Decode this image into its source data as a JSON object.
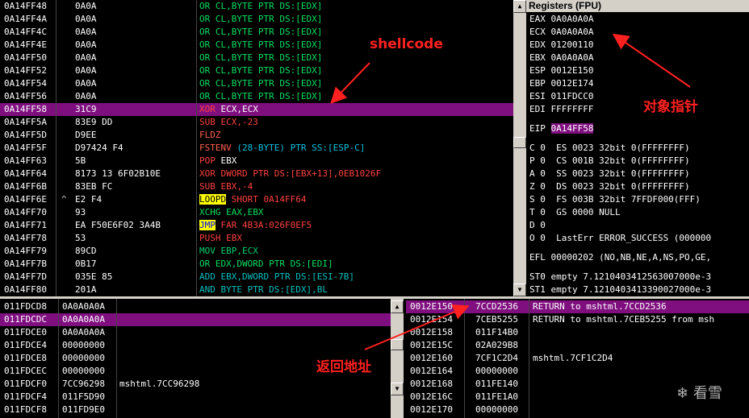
{
  "disasm": [
    {
      "addr": "0A14FF48",
      "mark": "",
      "hex": "0A0A",
      "ins": [
        [
          "OR",
          "t-or"
        ],
        [
          " CL,BYTE PTR DS:[EDX]",
          "t-or"
        ]
      ]
    },
    {
      "addr": "0A14FF4A",
      "mark": "",
      "hex": "0A0A",
      "ins": [
        [
          "OR",
          "t-or"
        ],
        [
          " CL,BYTE PTR DS:[EDX]",
          "t-or"
        ]
      ]
    },
    {
      "addr": "0A14FF4C",
      "mark": "",
      "hex": "0A0A",
      "ins": [
        [
          "OR",
          "t-or"
        ],
        [
          " CL,BYTE PTR DS:[EDX]",
          "t-or"
        ]
      ]
    },
    {
      "addr": "0A14FF4E",
      "mark": "",
      "hex": "0A0A",
      "ins": [
        [
          "OR",
          "t-or"
        ],
        [
          " CL,BYTE PTR DS:[EDX]",
          "t-or"
        ]
      ]
    },
    {
      "addr": "0A14FF50",
      "mark": "",
      "hex": "0A0A",
      "ins": [
        [
          "OR",
          "t-or"
        ],
        [
          " CL,BYTE PTR DS:[EDX]",
          "t-or"
        ]
      ]
    },
    {
      "addr": "0A14FF52",
      "mark": "",
      "hex": "0A0A",
      "ins": [
        [
          "OR",
          "t-or"
        ],
        [
          " CL,BYTE PTR DS:[EDX]",
          "t-or"
        ]
      ]
    },
    {
      "addr": "0A14FF54",
      "mark": "",
      "hex": "0A0A",
      "ins": [
        [
          "OR",
          "t-or"
        ],
        [
          " CL,BYTE PTR DS:[EDX]",
          "t-or"
        ]
      ]
    },
    {
      "addr": "0A14FF56",
      "mark": "",
      "hex": "0A0A",
      "ins": [
        [
          "OR",
          "t-or"
        ],
        [
          " CL,BYTE PTR DS:[EDX]",
          "t-or"
        ]
      ]
    },
    {
      "addr": "0A14FF58",
      "mark": "",
      "hex": "31C9",
      "sel": true,
      "ins": [
        [
          "XOR",
          "t-kw"
        ],
        [
          " ECX,ECX",
          "t-num"
        ]
      ]
    },
    {
      "addr": "0A14FF5A",
      "mark": "",
      "hex": "83E9 DD",
      "ins": [
        [
          "SUB",
          "t-kw"
        ],
        [
          " ECX,-23",
          "t-kw"
        ]
      ]
    },
    {
      "addr": "0A14FF5D",
      "mark": "",
      "hex": "D9EE",
      "ins": [
        [
          "FLDZ",
          "t-fpu"
        ]
      ]
    },
    {
      "addr": "0A14FF5F",
      "mark": "",
      "hex": "D97424 F4",
      "ins": [
        [
          "FSTENV",
          "t-fpu"
        ],
        [
          " (28-BYTE) PTR SS:[ESP-C]",
          "t-cyan"
        ]
      ]
    },
    {
      "addr": "0A14FF63",
      "mark": "",
      "hex": "5B",
      "ins": [
        [
          "POP",
          "t-push"
        ],
        [
          " EBX",
          "t-num"
        ]
      ]
    },
    {
      "addr": "0A14FF64",
      "mark": "",
      "hex": "8173 13 6F02B10E",
      "ins": [
        [
          "XOR",
          "t-kw"
        ],
        [
          " DWORD PTR DS:[EBX+13],0EB1026F",
          "t-kw"
        ]
      ]
    },
    {
      "addr": "0A14FF6B",
      "mark": "",
      "hex": "83EB FC",
      "ins": [
        [
          "SUB",
          "t-kw"
        ],
        [
          " EBX,-4",
          "t-kw"
        ]
      ]
    },
    {
      "addr": "0A14FF6E",
      "mark": "^",
      "hex": "E2 F4",
      "ins": [
        [
          "LOOPD",
          "t-loop"
        ],
        [
          " SHORT 0A14FF64",
          "t-kw"
        ]
      ]
    },
    {
      "addr": "0A14FF70",
      "mark": "",
      "hex": "93",
      "ins": [
        [
          "XCHG EAX,EBX",
          "t-xchg"
        ]
      ]
    },
    {
      "addr": "0A14FF71",
      "mark": "",
      "hex": "EA F50E6F02 3A4B",
      "ins": [
        [
          "JMP",
          "t-call"
        ],
        [
          " FAR 4B3A:026F0EF5",
          "t-kw"
        ]
      ]
    },
    {
      "addr": "0A14FF78",
      "mark": "",
      "hex": "53",
      "ins": [
        [
          "PUSH EBX",
          "t-push"
        ]
      ]
    },
    {
      "addr": "0A14FF79",
      "mark": "",
      "hex": "89CD",
      "ins": [
        [
          "MOV EBP,ECX",
          "t-mov"
        ]
      ]
    },
    {
      "addr": "0A14FF7B",
      "mark": "",
      "hex": "0B17",
      "ins": [
        [
          "OR EDX,DWORD PTR DS:[EDI]",
          "t-or"
        ]
      ]
    },
    {
      "addr": "0A14FF7D",
      "mark": "",
      "hex": "035E 85",
      "ins": [
        [
          "ADD EBX,DWORD PTR DS:[ESI-7B]",
          "t-add"
        ]
      ]
    },
    {
      "addr": "0A14FF80",
      "mark": "",
      "hex": "201A",
      "ins": [
        [
          "AND BYTE PTR DS:[EDX],BL",
          "t-and"
        ]
      ]
    }
  ],
  "registers": {
    "title": "Registers (FPU)",
    "lines": [
      "EAX 0A0A0A0A",
      "ECX 0A0A0A0A",
      "EDX 01200110",
      "EBX 0A0A0A0A",
      "ESP 0012E150",
      "EBP 0012E174",
      "ESI 011FDCC0",
      "EDI FFFFFFFF"
    ],
    "eip_label": "EIP ",
    "eip_value": "0A14FF58",
    "flags": [
      "C 0  ES 0023 32bit 0(FFFFFFFF)",
      "P 0  CS 001B 32bit 0(FFFFFFFF)",
      "A 0  SS 0023 32bit 0(FFFFFFFF)",
      "Z 0  DS 0023 32bit 0(FFFFFFFF)",
      "S 0  FS 003B 32bit 7FFDF000(FFF)",
      "T 0  GS 0000 NULL",
      "D 0",
      "O 0  LastErr ERROR_SUCCESS (000000"
    ],
    "efl": "EFL 00000202 (NO,NB,NE,A,NS,PO,GE,",
    "st": [
      "ST0 empty 7.1210403412563007000e-3",
      "ST1 empty 7.1210403413390027000e-3"
    ]
  },
  "dump": [
    {
      "addr": "011FDCD8",
      "val": "0A0A0A0A",
      "cmt": ""
    },
    {
      "addr": "011FDCDC",
      "val": "0A0A0A0A",
      "cmt": "",
      "sel": true
    },
    {
      "addr": "011FDCE0",
      "val": "0A0A0A0A",
      "cmt": ""
    },
    {
      "addr": "011FDCE4",
      "val": "00000000",
      "cmt": ""
    },
    {
      "addr": "011FDCE8",
      "val": "00000000",
      "cmt": ""
    },
    {
      "addr": "011FDCEC",
      "val": "00000000",
      "cmt": ""
    },
    {
      "addr": "011FDCF0",
      "val": "7CC96298",
      "cmt": "mshtml.7CC96298"
    },
    {
      "addr": "011FDCF4",
      "val": "011F5D90",
      "cmt": ""
    },
    {
      "addr": "011FDCF8",
      "val": "011FD9E0",
      "cmt": ""
    }
  ],
  "stack": [
    {
      "addr": "0012E150",
      "val": "7CCD2536",
      "cmt": "RETURN to mshtml.7CCD2536",
      "sel": true
    },
    {
      "addr": "0012E154",
      "val": "7CEB5255",
      "cmt": "RETURN to mshtml.7CEB5255 from msh"
    },
    {
      "addr": "0012E158",
      "val": "011F14B0",
      "cmt": ""
    },
    {
      "addr": "0012E15C",
      "val": "02A029B8",
      "cmt": ""
    },
    {
      "addr": "0012E160",
      "val": "7CF1C2D4",
      "cmt": "mshtml.7CF1C2D4"
    },
    {
      "addr": "0012E164",
      "val": "00000000",
      "cmt": ""
    },
    {
      "addr": "0012E168",
      "val": "011FE140",
      "cmt": ""
    },
    {
      "addr": "0012E16C",
      "val": "011FE1A0",
      "cmt": ""
    },
    {
      "addr": "0012E170",
      "val": "00000000",
      "cmt": ""
    }
  ],
  "annotations": {
    "shellcode": "shellcode",
    "object_pointer": "对象指针",
    "return_address": "返回地址"
  },
  "watermark": "看雪",
  "icons": {
    "scroll_up": "arrow-up-icon",
    "scroll_down": "arrow-down-icon",
    "watermark": "snowflake-icon"
  }
}
